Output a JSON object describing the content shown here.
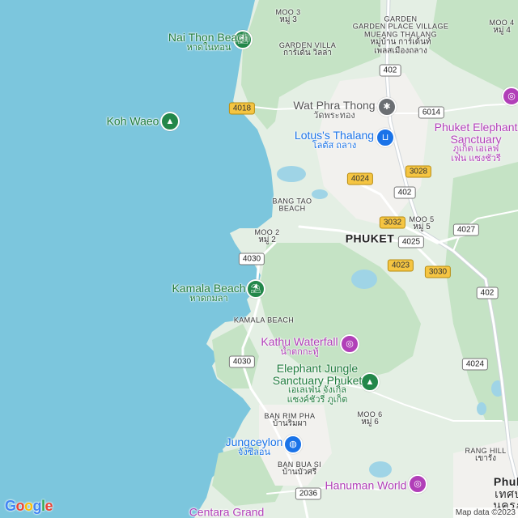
{
  "map": {
    "colors": {
      "water": "#7cc6dd",
      "land": "#e4efe4",
      "forest": "#c5e3c5",
      "urban": "#f2f1ee",
      "road": "#ffffff",
      "major_road": "#cfd5da"
    },
    "pois": [
      {
        "id": "nai-thon",
        "name": "Nai Thon Beach",
        "name_th": "หาดในทอน",
        "kind": "beach",
        "color": "green",
        "icon": "beach-icon"
      },
      {
        "id": "koh-waeo",
        "name": "Koh Waeo",
        "kind": "park",
        "color": "green",
        "icon": "tree-icon"
      },
      {
        "id": "wat-phra-thong",
        "name": "Wat Phra Thong",
        "name_th": "วัดพระทอง",
        "kind": "temple",
        "color": "gray",
        "icon": "temple-icon"
      },
      {
        "id": "lotus",
        "name": "Lotus's Thalang",
        "name_th": "โลตัส ถลาง",
        "kind": "shopping",
        "color": "blue",
        "icon": "cart-icon"
      },
      {
        "id": "phuket-elephant",
        "name": "Phuket Elephant",
        "name_l2": "Sanctuary",
        "name_th": "ภูเก็ต เอเลฟ",
        "name_th2": "เฟ่น แซงชัวรี",
        "kind": "attraction",
        "color": "purple",
        "icon": "camera-icon"
      },
      {
        "id": "kamala-beach",
        "name": "Kamala Beach",
        "name_th": "หาดกมลา",
        "kind": "beach",
        "color": "green",
        "icon": "beach-icon"
      },
      {
        "id": "kathu-waterfall",
        "name": "Kathu Waterfall",
        "name_th": "น้ำตกกะทู้",
        "kind": "attraction",
        "color": "purple",
        "icon": "camera-icon"
      },
      {
        "id": "elephant-jungle",
        "name": "Elephant Jungle",
        "name_l2": "Sanctuary Phuket",
        "name_th": "เอเลเฟ่น จังเกิ้ล",
        "name_th2": "แซงค์ชัวรี่ ภูเก็ต",
        "kind": "park",
        "color": "green",
        "icon": "tree-icon"
      },
      {
        "id": "jungceylon",
        "name": "Jungceylon",
        "name_th": "จังซีลอน",
        "kind": "shopping",
        "color": "blue",
        "icon": "bag-icon"
      },
      {
        "id": "hanuman-world",
        "name": "Hanuman World",
        "kind": "attraction",
        "color": "purple",
        "icon": "camera-icon"
      },
      {
        "id": "centara",
        "name": "Centara Grand",
        "kind": "hotel",
        "color": "purple"
      }
    ],
    "areas": [
      {
        "id": "moo3",
        "name": "MOO 3",
        "name_th": "หมู่ 3"
      },
      {
        "id": "garden-place",
        "name": "GARDEN PLACE VILLAGE",
        "name_l2": "MUEANG THALANG",
        "name_th": "หมู่บ้าน การ์เด้นท์",
        "name_th2": "เพลสเมืองถลาง"
      },
      {
        "id": "moo4",
        "name": "MOO 4",
        "name_th": "หมู่ 4"
      },
      {
        "id": "garden-villa",
        "name": "GARDEN VILLA",
        "name_th": "การ์เด้น วิลล่า"
      },
      {
        "id": "bang-tao",
        "name": "BANG TAO",
        "name_l2": "BEACH"
      },
      {
        "id": "moo2",
        "name": "MOO 2",
        "name_th": "หมู่ 2"
      },
      {
        "id": "moo5",
        "name": "MOO 5",
        "name_th": "หมู่ 5"
      },
      {
        "id": "kamala-area",
        "name": "KAMALA BEACH"
      },
      {
        "id": "ban-rim-pha",
        "name": "BAN RIM PHA",
        "name_th": "บ้านริมผา"
      },
      {
        "id": "moo6",
        "name": "MOO 6",
        "name_th": "หมู่ 6"
      },
      {
        "id": "ban-bua-si",
        "name": "BAN BUA SI",
        "name_th": "บ้านบัวศรี"
      },
      {
        "id": "rang-hill",
        "name": "RANG HILL",
        "name_th": "เขารัง"
      }
    ],
    "cities": [
      {
        "id": "phuket",
        "name": "PHUKET"
      },
      {
        "id": "phuket-town",
        "name": "Phuk",
        "name_th": "เทศบ",
        "name_th2": "นครภู"
      }
    ],
    "shields": [
      {
        "id": "r402a",
        "num": "402",
        "style": "white"
      },
      {
        "id": "r4018",
        "num": "4018",
        "style": "yellow"
      },
      {
        "id": "r6014",
        "num": "6014",
        "style": "white"
      },
      {
        "id": "r4024a",
        "num": "4024",
        "style": "yellow"
      },
      {
        "id": "r3028",
        "num": "3028",
        "style": "yellow"
      },
      {
        "id": "r402b",
        "num": "402",
        "style": "white"
      },
      {
        "id": "r3032",
        "num": "3032",
        "style": "yellow"
      },
      {
        "id": "r4025",
        "num": "4025",
        "style": "white"
      },
      {
        "id": "r4027",
        "num": "4027",
        "style": "white"
      },
      {
        "id": "r4030a",
        "num": "4030",
        "style": "white"
      },
      {
        "id": "r4023",
        "num": "4023",
        "style": "yellow"
      },
      {
        "id": "r3030",
        "num": "3030",
        "style": "yellow"
      },
      {
        "id": "r402c",
        "num": "402",
        "style": "white"
      },
      {
        "id": "r4030b",
        "num": "4030",
        "style": "white"
      },
      {
        "id": "r4024b",
        "num": "4024",
        "style": "white"
      },
      {
        "id": "r2036",
        "num": "2036",
        "style": "white"
      }
    ],
    "logo": "Google",
    "attribution": "Map data ©2023"
  }
}
